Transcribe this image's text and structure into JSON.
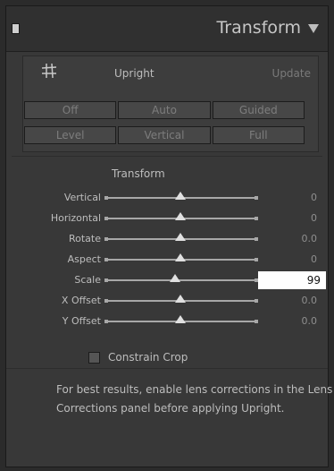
{
  "panel": {
    "title": "Transform"
  },
  "upright": {
    "label": "Upright",
    "update_label": "Update",
    "modes_row1": [
      "Off",
      "Auto",
      "Guided"
    ],
    "modes_row2": [
      "Level",
      "Vertical",
      "Full"
    ]
  },
  "transform": {
    "section_title": "Transform",
    "sliders": [
      {
        "label": "Vertical",
        "value": "0"
      },
      {
        "label": "Horizontal",
        "value": "0"
      },
      {
        "label": "Rotate",
        "value": "0.0"
      },
      {
        "label": "Aspect",
        "value": "0"
      },
      {
        "label": "Scale",
        "value": "99"
      },
      {
        "label": "X Offset",
        "value": "0.0"
      },
      {
        "label": "Y Offset",
        "value": "0.0"
      }
    ],
    "constrain_crop_label": "Constrain Crop",
    "constrain_crop_checked": false
  },
  "info": {
    "text": "For best results, enable lens corrections in the Lens Corrections panel before applying Upright."
  },
  "colors": {
    "panel_bg": "#383838",
    "header_bg": "#303030",
    "active_field_bg": "#ffffff"
  }
}
